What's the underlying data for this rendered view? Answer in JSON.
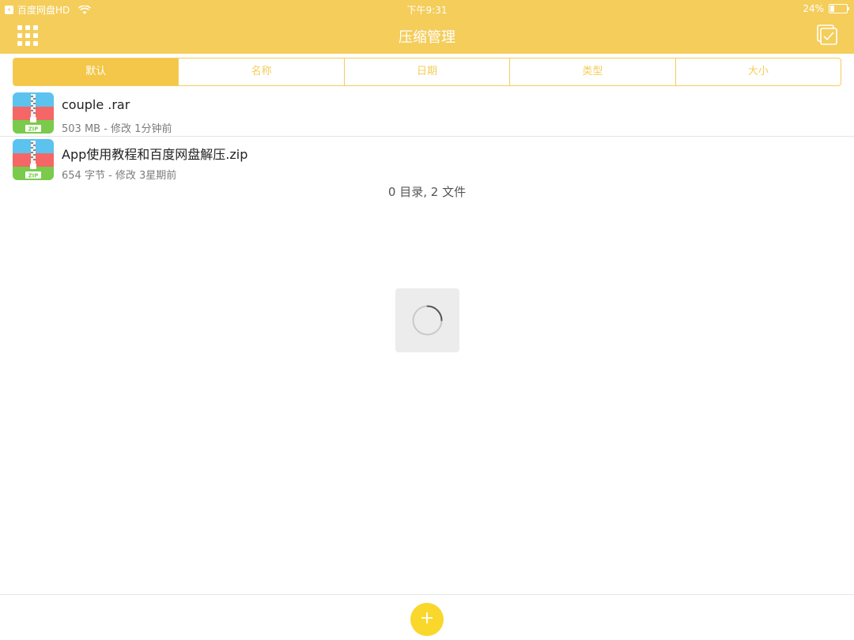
{
  "status_bar": {
    "back_app": "百度网盘HD",
    "time": "下午9:31",
    "battery": "24%",
    "battery_level": 0.24
  },
  "nav": {
    "title": "压缩管理",
    "grid_icon": "grid-icon",
    "select_icon": "checkbox-icon"
  },
  "sort_tabs": [
    {
      "label": "默认",
      "active": true
    },
    {
      "label": "名称",
      "active": false
    },
    {
      "label": "日期",
      "active": false
    },
    {
      "label": "类型",
      "active": false
    },
    {
      "label": "大小",
      "active": false
    }
  ],
  "files": [
    {
      "name": "couple .rar",
      "meta": "503 MB - 修改 1分钟前",
      "icon": "zip-icon",
      "icon_label": "ZIP"
    },
    {
      "name": "App使用教程和百度网盘解压.zip",
      "meta": "654 字节 - 修改 3星期前",
      "icon": "zip-icon",
      "icon_label": "ZIP"
    }
  ],
  "summary": "0 目录, 2 文件",
  "bottom": {
    "add_label": "+"
  },
  "colors": {
    "accent": "#F4CD5B",
    "active_tab": "#F4C649",
    "add_button": "#F9D72B"
  }
}
